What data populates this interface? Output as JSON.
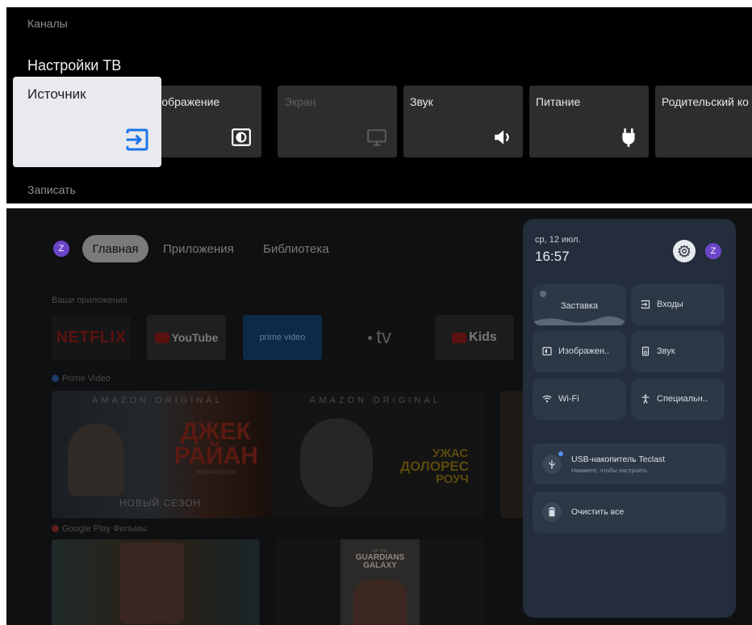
{
  "tv_settings": {
    "channels_label": "Каналы",
    "title": "Настройки ТВ",
    "record_label": "Записать",
    "cards": [
      {
        "label": "Источник",
        "icon": "input-icon",
        "selected": true
      },
      {
        "label": "Изображение",
        "icon": "picture-icon"
      },
      {
        "label": "Экран",
        "icon": "screen-icon",
        "disabled": true
      },
      {
        "label": "Звук",
        "icon": "sound-icon"
      },
      {
        "label": "Питание",
        "icon": "power-plug-icon"
      },
      {
        "label": "Родительский ко",
        "icon": "lock-icon"
      }
    ]
  },
  "home": {
    "avatar_letter": "Z",
    "tabs": [
      "Главная",
      "Приложения",
      "Библиотека"
    ],
    "apps_section": "Ваши приложения",
    "apps": [
      "NETFLIX",
      "YouTube",
      "prime video",
      "tv",
      "Kids"
    ],
    "prime_section": "Prime Video",
    "prime_posters": [
      {
        "brand": "AMAZON ORIGINAL",
        "title_line1": "ДЖЕК",
        "title_line2": "РАЙАН",
        "subtitle": "ТОМА КЛЭНСИ",
        "tag": "НОВЫЙ СЕЗОН"
      },
      {
        "brand": "AMAZON ORIGINAL",
        "title_line1": "УЖАС",
        "title_line2": "ДОЛОРЕС",
        "title_line3": "РОУЧ"
      }
    ],
    "play_section": "Google Play Фильмы",
    "play_posters": [
      {
        "title": ""
      },
      {
        "title": "GUARDIANS",
        "title_line2": "GALAXY",
        "small": "OF THE"
      }
    ]
  },
  "quick_settings": {
    "date": "ср, 12 июл.",
    "time": "16:57",
    "avatar_letter": "Z",
    "tiles": [
      {
        "label": "Заставка",
        "icon": "screensaver-icon"
      },
      {
        "label": "Входы",
        "icon": "input-icon"
      },
      {
        "label": "Изображен..",
        "icon": "picture-icon"
      },
      {
        "label": "Звук",
        "icon": "speaker-icon"
      },
      {
        "label": "Wi-Fi",
        "icon": "wifi-icon"
      },
      {
        "label": "Специальн..",
        "icon": "accessibility-icon"
      }
    ],
    "usb": {
      "title": "USB-накопитель Teclast",
      "subtitle": "Нажмите, чтобы настроить."
    },
    "clear_all": "Очистить все"
  },
  "colors": {
    "accent_purple": "#6b45c8",
    "selected_card": "#e8eaed",
    "qs_panel": "#232d3b",
    "input_icon_blue": "#1a73e8"
  }
}
